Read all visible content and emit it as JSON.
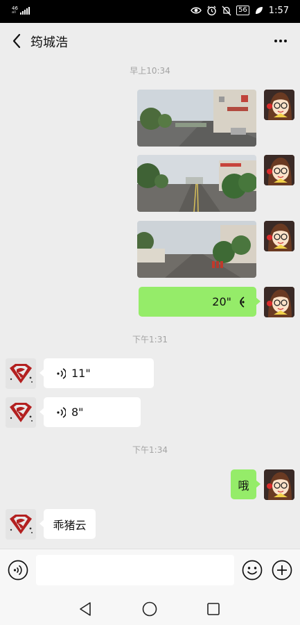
{
  "status_bar": {
    "network_top": "46",
    "network_bottom": "all",
    "battery": "56",
    "time": "1:57"
  },
  "header": {
    "title": "筠城浩",
    "back_icon": "chevron-left-icon",
    "more_icon": "more-horizontal-icon"
  },
  "messages": {
    "ts1": "早上10:34",
    "voice_me": "20\"",
    "ts2": "下午1:31",
    "voice_other1": "11\"",
    "voice_other2": "8\"",
    "ts3": "下午1:34",
    "text_me": "哦",
    "text_other": "乖猪云"
  },
  "input_bar": {
    "voice_icon": "voice-mode-icon",
    "emoji_icon": "emoji-icon",
    "plus_icon": "plus-circle-icon",
    "placeholder": ""
  },
  "nav_bar": {
    "back": "triangle-back-icon",
    "home": "circle-home-icon",
    "recents": "square-recents-icon"
  },
  "colors": {
    "my_bubble": "#95ec69",
    "other_bubble": "#ffffff",
    "background": "#ededed"
  }
}
